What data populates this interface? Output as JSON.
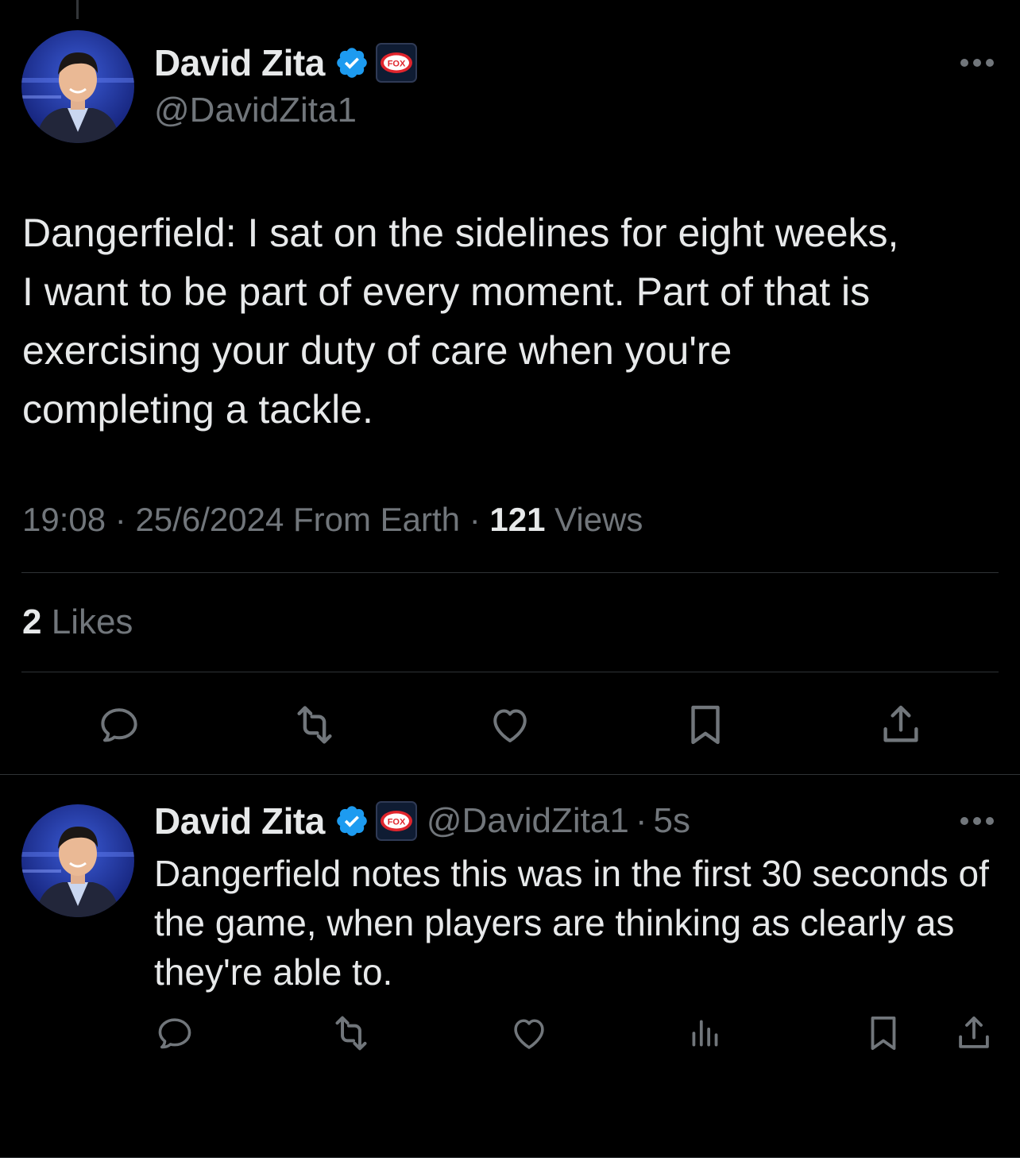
{
  "main_tweet": {
    "author_name": "David Zita",
    "handle": "@DavidZita1",
    "text_lines": [
      "Dangerfield: I sat on the sidelines for eight weeks,",
      "I want to be part of every moment. Part of that is",
      "exercising your duty of care when you're",
      "completing a tackle."
    ],
    "time": "19:08",
    "date": "25/6/2024",
    "source": "From Earth",
    "separator": "·",
    "views_count": "121",
    "views_label": "Views",
    "likes_count": "2",
    "likes_label": "Likes"
  },
  "reply_tweet": {
    "author_name": "David Zita",
    "handle": "@DavidZita1",
    "separator": "·",
    "age": "5s",
    "text": "Dangerfield notes this was in the first 30 seconds of the game, when players are thinking as clearly as they're able to."
  },
  "badge": {
    "affiliation_text": "FOX"
  },
  "colors": {
    "background": "#000000",
    "text_primary": "#e7e9ea",
    "text_secondary": "#71767b",
    "divider": "#2f3336",
    "verified_blue": "#1d9bf0"
  },
  "icons": {
    "reply": "comment-bubble-icon",
    "retweet": "retweet-icon",
    "like": "heart-icon",
    "bookmark": "bookmark-icon",
    "share": "share-icon",
    "views": "analytics-icon",
    "more": "more-dots-icon",
    "verified": "verified-badge-icon",
    "affiliation": "fox-badge-icon"
  }
}
